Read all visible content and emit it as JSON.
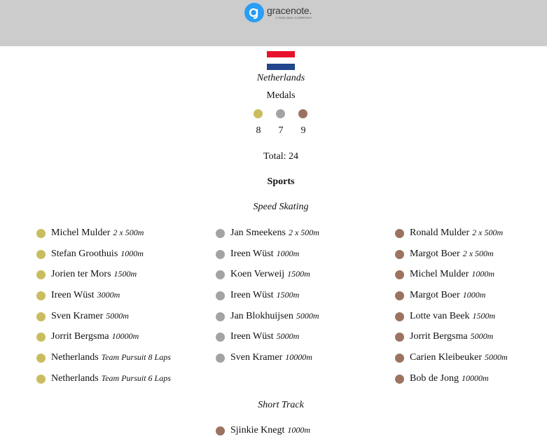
{
  "header": {
    "logo_text": "gracenote.",
    "logo_subtext": "A NIELSEN COMPANY"
  },
  "country": {
    "name": "Netherlands",
    "flag_colors": [
      "#e8112d",
      "#ffffff",
      "#21468b"
    ]
  },
  "medals": {
    "label": "Medals",
    "gold": "8",
    "silver": "7",
    "bronze": "9",
    "total_label": "Total: 24"
  },
  "colors": {
    "gold": "#c9bd5f",
    "silver": "#a3a3a3",
    "bronze": "#9a7461",
    "header_bg": "#cccccc",
    "logo_blue": "#2a9df4"
  },
  "sports_heading": "Sports",
  "sports": [
    {
      "name": "Speed Skating",
      "gold": [
        {
          "athlete": "Michel Mulder",
          "event": "2 x 500m"
        },
        {
          "athlete": "Stefan Groothuis",
          "event": "1000m"
        },
        {
          "athlete": "Jorien ter Mors",
          "event": "1500m"
        },
        {
          "athlete": "Ireen Wüst",
          "event": "3000m"
        },
        {
          "athlete": "Sven Kramer",
          "event": "5000m"
        },
        {
          "athlete": "Jorrit Bergsma",
          "event": "10000m"
        },
        {
          "athlete": "Netherlands",
          "event": "Team Pursuit 8 Laps"
        },
        {
          "athlete": "Netherlands",
          "event": "Team Pursuit 6 Laps"
        }
      ],
      "silver": [
        {
          "athlete": "Jan Smeekens",
          "event": "2 x 500m"
        },
        {
          "athlete": "Ireen Wüst",
          "event": "1000m"
        },
        {
          "athlete": "Koen Verweij",
          "event": "1500m"
        },
        {
          "athlete": "Ireen Wüst",
          "event": "1500m"
        },
        {
          "athlete": "Jan Blokhuijsen",
          "event": "5000m"
        },
        {
          "athlete": "Ireen Wüst",
          "event": "5000m"
        },
        {
          "athlete": "Sven Kramer",
          "event": "10000m"
        }
      ],
      "bronze": [
        {
          "athlete": "Ronald Mulder",
          "event": "2 x 500m"
        },
        {
          "athlete": "Margot Boer",
          "event": "2 x 500m"
        },
        {
          "athlete": "Michel Mulder",
          "event": "1000m"
        },
        {
          "athlete": "Margot Boer",
          "event": "1000m"
        },
        {
          "athlete": "Lotte van Beek",
          "event": "1500m"
        },
        {
          "athlete": "Jorrit Bergsma",
          "event": "5000m"
        },
        {
          "athlete": "Carien Kleibeuker",
          "event": "5000m"
        },
        {
          "athlete": "Bob de Jong",
          "event": "10000m"
        }
      ]
    },
    {
      "name": "Short Track",
      "bronze": [
        {
          "athlete": "Sjinkie Knegt",
          "event": "1000m"
        }
      ]
    }
  ]
}
